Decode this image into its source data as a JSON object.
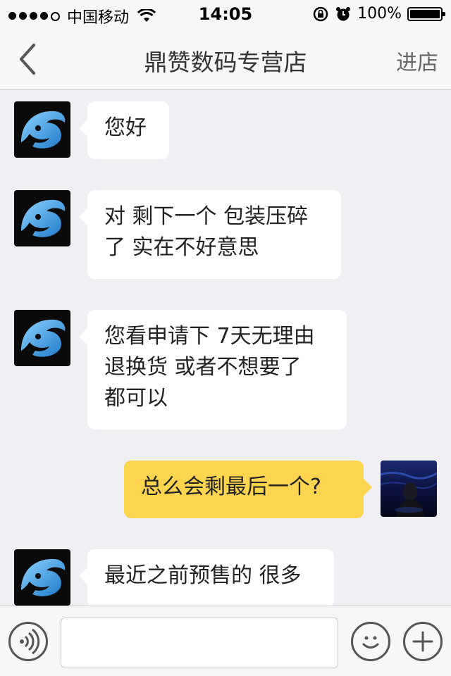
{
  "status_bar": {
    "carrier": "中国移动",
    "time": "14:05",
    "battery": "100%",
    "battery_level": 1.0,
    "signal_bars": 4
  },
  "nav": {
    "back_icon": "chevron-left-icon",
    "title": "鼎赞数码专营店",
    "enter_shop": "进店"
  },
  "messages": [
    {
      "sender": "shop",
      "text": "您好"
    },
    {
      "sender": "shop",
      "text": "对 剩下一个 包装压碎\n了 实在不好意思"
    },
    {
      "sender": "shop",
      "text": "您看申请下 7天无理由\n退换货 或者不想要了\n都可以"
    },
    {
      "sender": "user",
      "text": "总么会剩最后一个?"
    },
    {
      "sender": "shop",
      "text": "最近之前预售的 很多"
    }
  ],
  "input_bar": {
    "voice_icon": "voice-icon",
    "placeholder": "",
    "emoji_icon": "emoji-icon",
    "plus_icon": "plus-icon"
  },
  "colors": {
    "incoming_bubble": "#ffffff",
    "outgoing_bubble": "#fdd54f",
    "background": "#efeff4"
  }
}
